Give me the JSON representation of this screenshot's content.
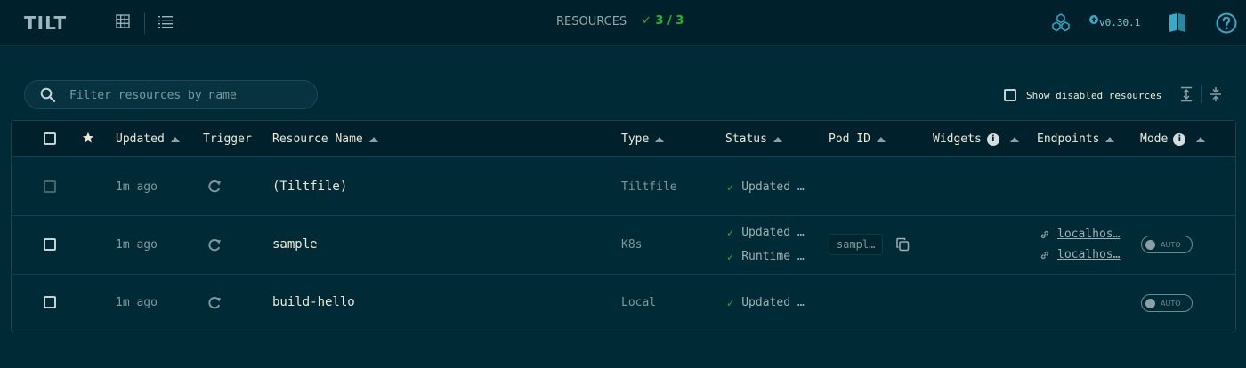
{
  "header": {
    "logo": "TILT",
    "resources_label": "RESOURCES",
    "resources_count": "✓ 3 / 3",
    "version": "v0.30.1"
  },
  "filter": {
    "placeholder": "Filter resources by name"
  },
  "controls": {
    "show_disabled_label": "Show disabled resources"
  },
  "table": {
    "columns": {
      "updated": "Updated",
      "trigger": "Trigger",
      "resource_name": "Resource Name",
      "type": "Type",
      "status": "Status",
      "pod_id": "Pod ID",
      "widgets": "Widgets",
      "endpoints": "Endpoints",
      "mode": "Mode"
    },
    "rows": [
      {
        "updated": "1m ago",
        "name": "(Tiltfile)",
        "type": "Tiltfile",
        "statuses": [
          "Updated …"
        ]
      },
      {
        "updated": "1m ago",
        "name": "sample",
        "type": "K8s",
        "statuses": [
          "Updated …",
          "Runtime …"
        ],
        "pod_id": "sampl…",
        "endpoints": [
          "localhos…",
          "localhos…"
        ],
        "mode": "AUTO"
      },
      {
        "updated": "1m ago",
        "name": "build-hello",
        "type": "Local",
        "statuses": [
          "Updated …"
        ],
        "mode": "AUTO"
      }
    ]
  },
  "colors": {
    "background": "#002b36",
    "header": "#00212b",
    "ok_green": "#20ba31",
    "text": "#eee8d5"
  }
}
